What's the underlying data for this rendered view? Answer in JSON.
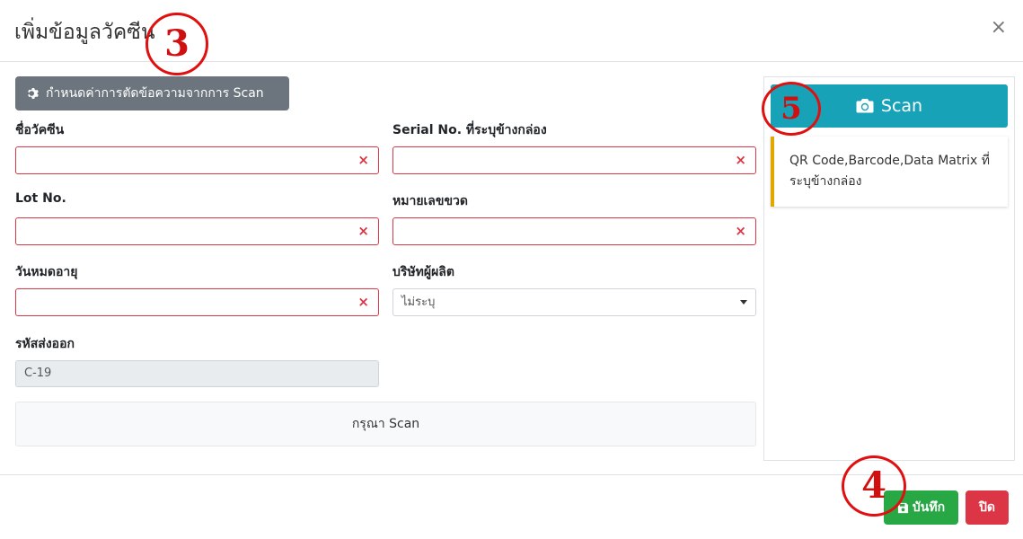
{
  "modal": {
    "title": "เพิ่มข้อมูลวัคซีน",
    "close_symbol": "×"
  },
  "settings_button": {
    "label": "กำหนดค่าการตัดข้อความจากการ Scan",
    "icon": "gear-icon"
  },
  "fields": {
    "vaccine_name": {
      "label": "ชื่อวัคซีน",
      "value": ""
    },
    "serial_no": {
      "label": "Serial No. ที่ระบุข้างกล่อง",
      "value": ""
    },
    "lot_no": {
      "label": "Lot No.",
      "value": ""
    },
    "bottle_no": {
      "label": "หมายเลขขวด",
      "value": ""
    },
    "expiry_date": {
      "label": "วันหมดอายุ",
      "value": ""
    },
    "manufacturer": {
      "label": "บริษัทผู้ผลิต",
      "selected": "ไม่ระบุ"
    },
    "export_code": {
      "label": "รหัสส่งออก",
      "value": "C-19"
    },
    "clear_symbol": "×"
  },
  "scan_hint": "กรุณา Scan",
  "right_panel": {
    "scan_button_label": "Scan",
    "scan_icon": "camera-icon",
    "callout_text": "QR Code,Barcode,Data Matrix ที่ระบุข้างกล่อง"
  },
  "footer": {
    "save_label": "บันทึก",
    "save_icon": "floppy-disk-icon",
    "close_label": "ปิด"
  },
  "annotations": {
    "a3": "3",
    "a4": "4",
    "a5": "5",
    "color": "#e01010"
  },
  "colors": {
    "secondary": "#6c757d",
    "info": "#17a2b8",
    "success": "#28a745",
    "danger": "#dc3545",
    "warning": "#e0a800"
  }
}
